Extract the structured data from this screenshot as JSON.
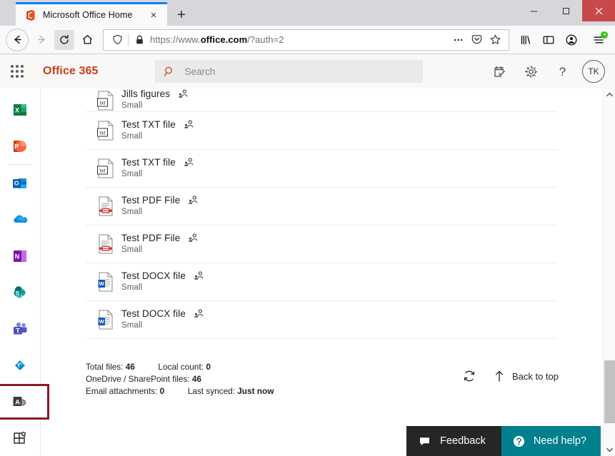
{
  "browser": {
    "tab": {
      "title": "Microsoft Office Home",
      "favicon": "office-favicon",
      "close_label": "×"
    },
    "new_tab_label": "+",
    "window_controls": {
      "minimize": "—",
      "maximize": "❐",
      "close": "✕"
    },
    "nav": {
      "back": "←",
      "forward": "→",
      "reload": "⟳",
      "home": "home-icon"
    },
    "url": {
      "prefix": "https://www.",
      "domain": "office.com",
      "suffix": "/?auth=2",
      "full": "https://www.office.com/?auth=2"
    },
    "toolbar_icons": [
      "page-actions-ellipsis-icon",
      "pocket-icon",
      "bookmark-star-icon",
      "library-icon",
      "sidebar-icon",
      "account-icon",
      "menu-icon"
    ]
  },
  "o365": {
    "waffle_label": "app-launcher",
    "brand": "Office 365",
    "search": {
      "placeholder": "Search",
      "value": ""
    },
    "header_icons": [
      "notes-check-icon",
      "gear-icon",
      "help-icon"
    ],
    "avatar_initials": "TK",
    "apps": [
      {
        "name": "excel",
        "label": "Excel",
        "color": "#107c41"
      },
      {
        "name": "powerpoint",
        "label": "PowerPoint",
        "color": "#c43e1c"
      },
      {
        "name": "outlook",
        "label": "Outlook",
        "color": "#0f6cbd"
      },
      {
        "name": "onedrive",
        "label": "OneDrive",
        "color": "#0f8ce0"
      },
      {
        "name": "onenote",
        "label": "OneNote",
        "color": "#7719aa"
      },
      {
        "name": "sharepoint",
        "label": "SharePoint",
        "color": "#038387"
      },
      {
        "name": "teams",
        "label": "Teams",
        "color": "#5059c9"
      },
      {
        "name": "yammer",
        "label": "Yammer",
        "color": "#106ebe"
      },
      {
        "name": "admin",
        "label": "Admin",
        "color": "#3c3c3c",
        "highlighted": true
      },
      {
        "name": "all-apps",
        "label": "All apps",
        "color": "#201f1e"
      }
    ],
    "highlight_color": "#8b1a27"
  },
  "files": [
    {
      "name": "Jills figures",
      "size": "Small",
      "type": "txt",
      "shared": true,
      "clipped": true
    },
    {
      "name": "Test TXT file",
      "size": "Small",
      "type": "txt",
      "shared": true
    },
    {
      "name": "Test TXT file",
      "size": "Small",
      "type": "txt",
      "shared": true
    },
    {
      "name": "Test PDF File",
      "size": "Small",
      "type": "pdf",
      "shared": true
    },
    {
      "name": "Test PDF File",
      "size": "Small",
      "type": "pdf",
      "shared": true
    },
    {
      "name": "Test DOCX file",
      "size": "Small",
      "type": "docx",
      "shared": true
    },
    {
      "name": "Test DOCX file",
      "size": "Small",
      "type": "docx",
      "shared": true
    }
  ],
  "stats": {
    "total_files_label": "Total files:",
    "total_files_value": "46",
    "local_count_label": "Local count:",
    "local_count_value": "0",
    "onedrive_label": "OneDrive / SharePoint files:",
    "onedrive_value": "46",
    "email_label": "Email attachments:",
    "email_value": "0",
    "last_synced_label": "Last synced:",
    "last_synced_value": "Just now",
    "refresh_label": "refresh",
    "back_to_top_label": "Back to top"
  },
  "bottom": {
    "feedback_label": "Feedback",
    "feedback_bg": "#262626",
    "need_help_label": "Need help?",
    "need_help_bg": "#00808c"
  }
}
